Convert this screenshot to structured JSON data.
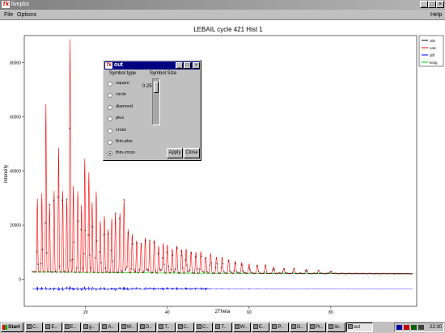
{
  "window": {
    "title": "liveplot",
    "controls": [
      "_",
      "□",
      "×"
    ]
  },
  "menu": {
    "file": "File",
    "options": "Options",
    "help": "Help"
  },
  "chart_data": {
    "type": "line",
    "title": "LEBAIL cycle 421 Hist 1",
    "xlabel": "2Theta",
    "ylabel": "Intensity",
    "xlim": [
      5,
      101
    ],
    "ylim": [
      -10000,
      90000
    ],
    "x_ticks": [
      20,
      40,
      60,
      80
    ],
    "y_ticks": [
      0,
      20000,
      40000,
      60000,
      80000
    ],
    "legend_position": "top-right",
    "series": [
      {
        "name": "obs",
        "color": "#000000"
      },
      {
        "name": "calc",
        "color": "#ff0000"
      },
      {
        "name": "diff",
        "color": "#0000ff"
      },
      {
        "name": "bckg",
        "color": "#00cc00"
      }
    ],
    "peaks": [
      [
        8.2,
        27000
      ],
      [
        9.3,
        29000
      ],
      [
        10.3,
        62000
      ],
      [
        11.2,
        25000
      ],
      [
        12.3,
        30000
      ],
      [
        13.4,
        46000
      ],
      [
        14.4,
        30000
      ],
      [
        15.4,
        27000
      ],
      [
        16.2,
        86000
      ],
      [
        17.0,
        32000
      ],
      [
        18.1,
        30000
      ],
      [
        19.0,
        25000
      ],
      [
        19.8,
        42000
      ],
      [
        20.8,
        37000
      ],
      [
        21.6,
        26000
      ],
      [
        22.6,
        30000
      ],
      [
        23.6,
        19000
      ],
      [
        24.6,
        21000
      ],
      [
        25.5,
        16000
      ],
      [
        26.4,
        20000
      ],
      [
        27.3,
        22000
      ],
      [
        28.4,
        22000
      ],
      [
        29.4,
        27000
      ],
      [
        30.4,
        16000
      ],
      [
        31.4,
        14000
      ],
      [
        32.5,
        12000
      ],
      [
        33.6,
        10000
      ],
      [
        34.6,
        13000
      ],
      [
        35.7,
        12000
      ],
      [
        36.8,
        11000
      ],
      [
        37.9,
        10000
      ],
      [
        39.0,
        11000
      ],
      [
        40.0,
        10000
      ],
      [
        41.2,
        9000
      ],
      [
        42.3,
        10000
      ],
      [
        43.5,
        8000
      ],
      [
        44.6,
        9000
      ],
      [
        45.8,
        8000
      ],
      [
        47.0,
        7000
      ],
      [
        48.2,
        8000
      ],
      [
        49.4,
        6000
      ],
      [
        50.6,
        7000
      ],
      [
        52.0,
        5500
      ],
      [
        53.4,
        6000
      ],
      [
        55.0,
        5000
      ],
      [
        56.6,
        4500
      ],
      [
        58.2,
        4000
      ],
      [
        60.0,
        3500
      ],
      [
        62.0,
        3000
      ],
      [
        64.0,
        2800
      ],
      [
        66.0,
        2400
      ],
      [
        68.5,
        2000
      ],
      [
        71.0,
        1800
      ],
      [
        74.0,
        1500
      ],
      [
        77.0,
        1200
      ],
      [
        80.0,
        1000
      ]
    ]
  },
  "dialog": {
    "title": "out",
    "controls": [
      "_",
      "□",
      "×"
    ],
    "symbol_type_label": "Symbol type",
    "symbol_size_label": "Symbol Size",
    "options": [
      "square",
      "circle",
      "diamond",
      "plus",
      "cross",
      "thin-plus",
      "thin-cross"
    ],
    "selected": "thin-cross",
    "size_value": "0.25",
    "apply_label": "Apply",
    "close_label": "Close"
  },
  "taskbar": {
    "start_label": "Start",
    "buttons": [
      "C..",
      "E..",
      "E..",
      "g..",
      "A..",
      "W..",
      "D..",
      "T..",
      "C..",
      "C..",
      "T..",
      "W..",
      "E..",
      "P..",
      "O..",
      "Pr..",
      "liv..",
      "out"
    ],
    "active": "out",
    "clock": "22:30"
  }
}
